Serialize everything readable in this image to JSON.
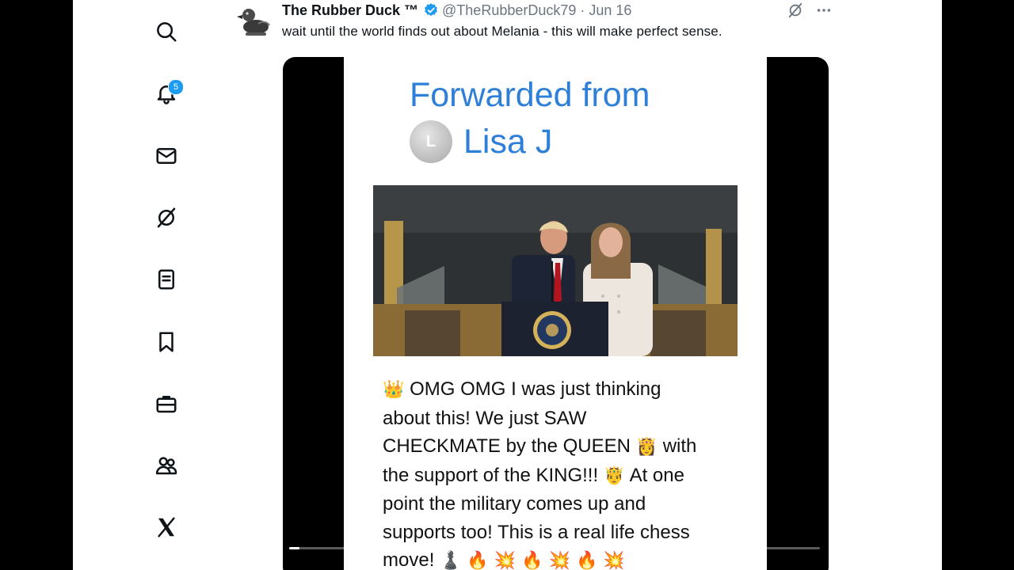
{
  "sidebar": {
    "items": [
      {
        "name": "search",
        "icon": "search-icon"
      },
      {
        "name": "notifications",
        "icon": "bell-icon",
        "badge": "5"
      },
      {
        "name": "messages",
        "icon": "mail-icon"
      },
      {
        "name": "grok",
        "icon": "grok-icon"
      },
      {
        "name": "lists",
        "icon": "list-icon"
      },
      {
        "name": "bookmarks",
        "icon": "bookmark-icon"
      },
      {
        "name": "jobs",
        "icon": "briefcase-icon"
      },
      {
        "name": "communities",
        "icon": "people-icon"
      },
      {
        "name": "x",
        "icon": "x-logo-icon"
      }
    ]
  },
  "tweet": {
    "author_name": "The Rubber Duck ™",
    "handle": "@TheRubberDuck79",
    "separator": "·",
    "date": "Jun 16",
    "text": "wait until the world finds out about Melania - this will make perfect sense."
  },
  "media": {
    "forwarded_label": "Forwarded from",
    "forwarded_initial": "L",
    "forwarded_name": "Lisa J",
    "lines": [
      {
        "pre": "👑",
        "text": " OMG OMG I was just thinking"
      },
      {
        "text": "about this! We just SAW"
      },
      {
        "text": "CHECKMATE by the QUEEN ",
        "post": "👸",
        "text2": " with"
      },
      {
        "text": "the support of the KING!!! ",
        "post": "🤴",
        "text2": " At one"
      },
      {
        "text": "point the military comes up and"
      },
      {
        "text": "supports too! This is a real life chess"
      },
      {
        "text": "move! ",
        "post": "♟️ 🔥 💥 🔥 💥 🔥 💥"
      }
    ],
    "progress": 0.02
  },
  "colors": {
    "accent": "#1d9bf0",
    "forward_blue": "#2e7fd8",
    "text": "#0f1419",
    "muted": "#6b7580"
  }
}
